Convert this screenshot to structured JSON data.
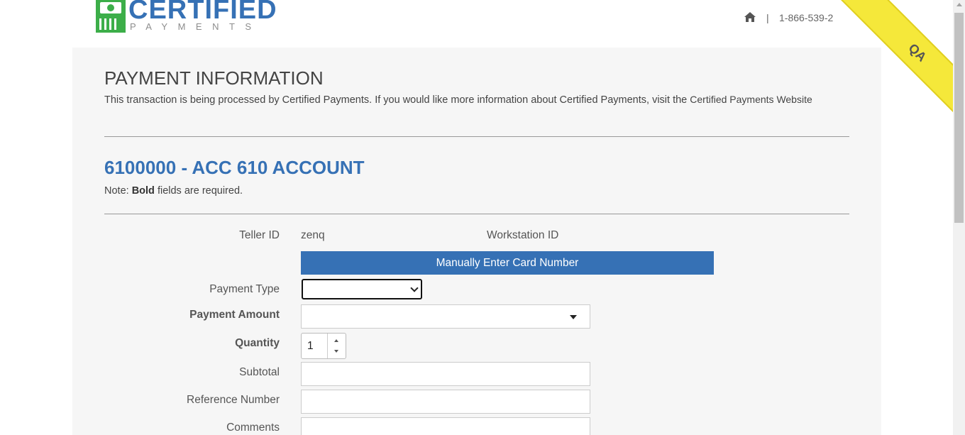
{
  "header": {
    "logo_word": "CERTIFIED",
    "logo_sub": "PAYMENTS",
    "separator": "|",
    "phone": "1-866-539-2",
    "env_ribbon": "QA"
  },
  "main": {
    "title": "PAYMENT INFORMATION",
    "intro_text": "This transaction is being processed by Certified Payments. If you would like more information about Certified Payments, visit the",
    "intro_link": "Certified Payments Website",
    "account_title": "6100000 - ACC 610 ACCOUNT",
    "note_prefix": "Note:",
    "note_bold": "Bold",
    "note_suffix": "fields are required."
  },
  "form": {
    "teller_id_label": "Teller ID",
    "teller_id_value": "zenq",
    "workstation_id_label": "Workstation ID",
    "manual_entry_label": "Manually Enter Card Number",
    "payment_type_label": "Payment Type",
    "payment_type_value": "",
    "payment_amount_label": "Payment Amount",
    "payment_amount_value": "",
    "quantity_label": "Quantity",
    "quantity_value": "1",
    "subtotal_label": "Subtotal",
    "subtotal_value": "",
    "reference_number_label": "Reference Number",
    "reference_number_value": "",
    "comments_label": "Comments",
    "comments_value": ""
  },
  "colors": {
    "brand_blue": "#3671b5",
    "brand_green": "#3cae49",
    "ribbon_yellow": "#f5e83a"
  }
}
